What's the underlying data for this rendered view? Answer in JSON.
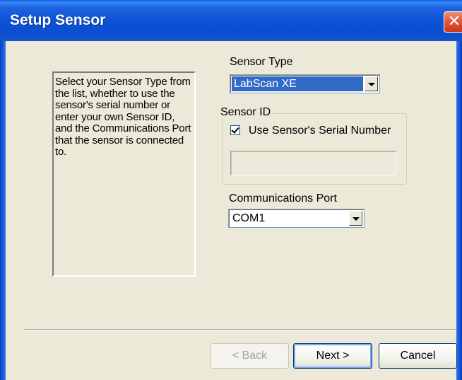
{
  "window": {
    "title": "Setup Sensor",
    "close_glyph": "✕"
  },
  "info": {
    "text": "Select your Sensor Type from the list, whether to use the sensor's serial number or enter your own Sensor ID, and the Communications Port that the sensor is connected to."
  },
  "sensor_type": {
    "label": "Sensor Type",
    "selected": "LabScan XE"
  },
  "sensor_id": {
    "group_label": "Sensor ID",
    "checkbox_label": "Use Sensor's Serial Number",
    "checkbox_checked": true,
    "value": ""
  },
  "comm_port": {
    "label": "Communications Port",
    "selected": "COM1"
  },
  "buttons": {
    "back": "< Back",
    "next": "Next >",
    "cancel": "Cancel"
  },
  "icons": {
    "close": "close-icon",
    "dropdown": "chevron-down-icon",
    "check": "checkmark-icon"
  },
  "colors": {
    "titlebar": "#0A4FD3",
    "face": "#ECE9D8",
    "selection": "#316AC5",
    "close": "#E25B3B"
  }
}
